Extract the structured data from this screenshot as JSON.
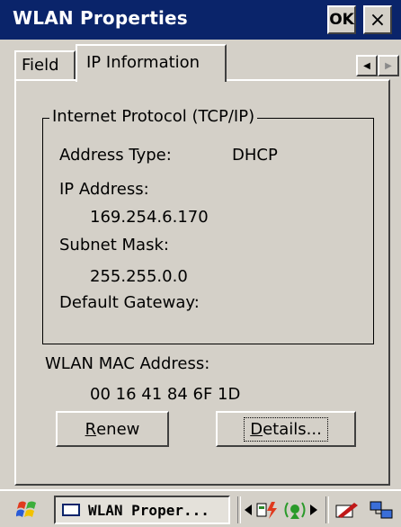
{
  "window": {
    "title": "WLAN Properties",
    "ok_label": "OK",
    "close_glyph": "×"
  },
  "tabs": [
    {
      "label": "Field",
      "selected": false
    },
    {
      "label": "IP Information",
      "selected": true
    }
  ],
  "scroll": {
    "left_icon": "arrow-left-icon",
    "right_icon": "arrow-right-icon"
  },
  "group": {
    "title": "Internet Protocol (TCP/IP)",
    "address_type_label": "Address Type:",
    "address_type_value": "DHCP",
    "ip_label": "IP Address:",
    "ip_value": "169.254.6.170",
    "subnet_label": "Subnet Mask:",
    "subnet_value": "255.255.0.0",
    "gateway_label": "Default Gateway:"
  },
  "mac": {
    "label": "WLAN MAC Address:",
    "value": "00 16 41 84 6F 1D"
  },
  "buttons": {
    "renew_accel": "R",
    "renew_rest": "enew",
    "details_accel": "D",
    "details_rest": "etails..."
  },
  "taskbar": {
    "active_task": "WLAN Proper...",
    "icons": [
      "start-windows-icon",
      "arrow-left-icon",
      "wlan-status-icon",
      "wireless-signal-icon",
      "arrow-right-icon",
      "pen-icon",
      "network-icon"
    ]
  }
}
